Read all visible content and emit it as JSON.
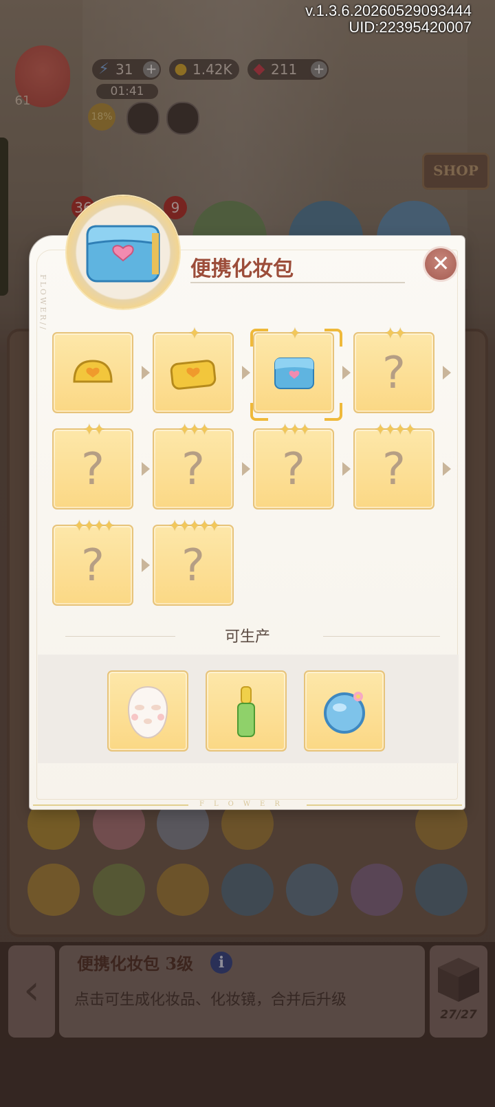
{
  "hud": {
    "version": "v.1.3.6.20260529093444",
    "uid": "UID:22395420007",
    "energy": "31",
    "coins": "1.42K",
    "gems": "211",
    "timer": "01:41",
    "level": "61",
    "progress_percent": "18%",
    "shop_sign": "SHOP",
    "badges": [
      "36",
      "9"
    ]
  },
  "dialog": {
    "title": "便携化妆包",
    "side_text": "FLOWER//",
    "close_icon": "close-icon",
    "chain": [
      {
        "icon": "yellow-pouch-icon",
        "stars": ""
      },
      {
        "icon": "yellow-cosmetic-bag-icon",
        "stars": "✦"
      },
      {
        "icon": "blue-cosmetic-bag-icon",
        "stars": "✦",
        "selected": true
      },
      {
        "icon": "unknown",
        "stars": "✦✦",
        "label": "?"
      },
      {
        "icon": "unknown",
        "stars": "✦✦",
        "label": "?"
      },
      {
        "icon": "unknown",
        "stars": "✦✦✦",
        "label": "?"
      },
      {
        "icon": "unknown",
        "stars": "✦✦✦",
        "label": "?"
      },
      {
        "icon": "unknown",
        "stars": "✦✦✦✦",
        "label": "?"
      },
      {
        "icon": "unknown",
        "stars": "✦✦✦✦",
        "label": "?"
      },
      {
        "icon": "unknown",
        "stars": "✦✦✦✦✦",
        "label": "?"
      }
    ],
    "produces_label": "可生产",
    "produces": [
      {
        "icon": "face-mask-icon"
      },
      {
        "icon": "lip-gloss-icon"
      },
      {
        "icon": "hand-mirror-icon"
      }
    ],
    "footer_text": "FLOWER"
  },
  "info": {
    "title": "便携化妆包 3级",
    "info_icon": "i",
    "description": "点击可生成化妆品、化妆镜，合并后升级",
    "box_count": "27/27"
  },
  "colors": {
    "title": "#9c4d3a",
    "cell_bg": "#fbd885",
    "close": "#a55c52"
  }
}
